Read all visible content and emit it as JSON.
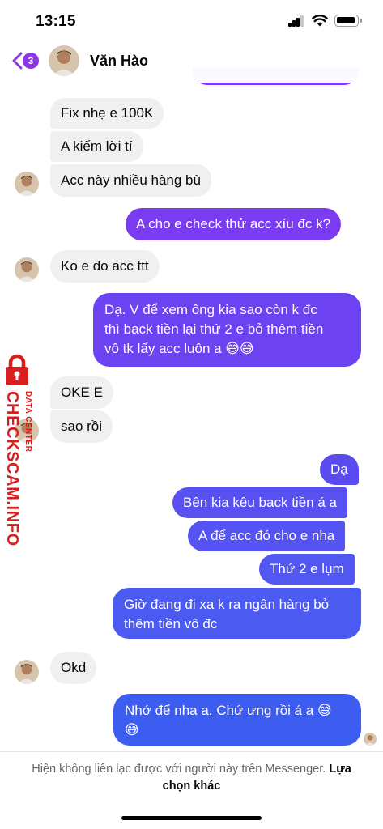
{
  "status_bar": {
    "time": "13:15"
  },
  "header": {
    "unread_count": "3",
    "contact_name": "Văn Hào"
  },
  "messages": [
    {
      "text": "Fix nhẹ e 100K"
    },
    {
      "text": "A kiếm lời tí"
    },
    {
      "text": "Acc này nhiều hàng bù"
    },
    {
      "text": "A cho e check thử acc xíu đc k?"
    },
    {
      "text": "Ko e do acc ttt"
    },
    {
      "text": "Dạ. V để xem ông kia sao còn k đc"
    },
    {
      "text": "thì back tiền lại thứ 2 e bỏ thêm tiền"
    },
    {
      "text": "vô tk lấy acc luôn a 😅😅"
    },
    {
      "text": "OKE E"
    },
    {
      "text": "sao rồi"
    },
    {
      "text": "Dạ"
    },
    {
      "text": "Bên kia kêu back tiền á a"
    },
    {
      "text": "A để acc đó cho e nha"
    },
    {
      "text": "Thứ 2 e lụm"
    },
    {
      "text": "Giờ đang đi xa k ra ngân hàng bỏ"
    },
    {
      "text": "thêm tiền vô đc"
    },
    {
      "text": "Okd"
    },
    {
      "text": "Nhớ để nha a. Chứ ưng rồi á a 😅"
    },
    {
      "text": "😅"
    }
  ],
  "watermark": {
    "brand": "CHECKSCAM.INFO",
    "sub": "DATA CENTER"
  },
  "footer": {
    "notice": "Hiện không liên lạc được với người này trên Messenger.",
    "link": "Lựa chọn khác"
  },
  "colors": {
    "outgoing_top": "#8038f0",
    "outgoing_bottom": "#3d5cf0",
    "incoming": "#f0f0f0",
    "accent": "#8b39e6",
    "watermark": "#d81e1e"
  }
}
